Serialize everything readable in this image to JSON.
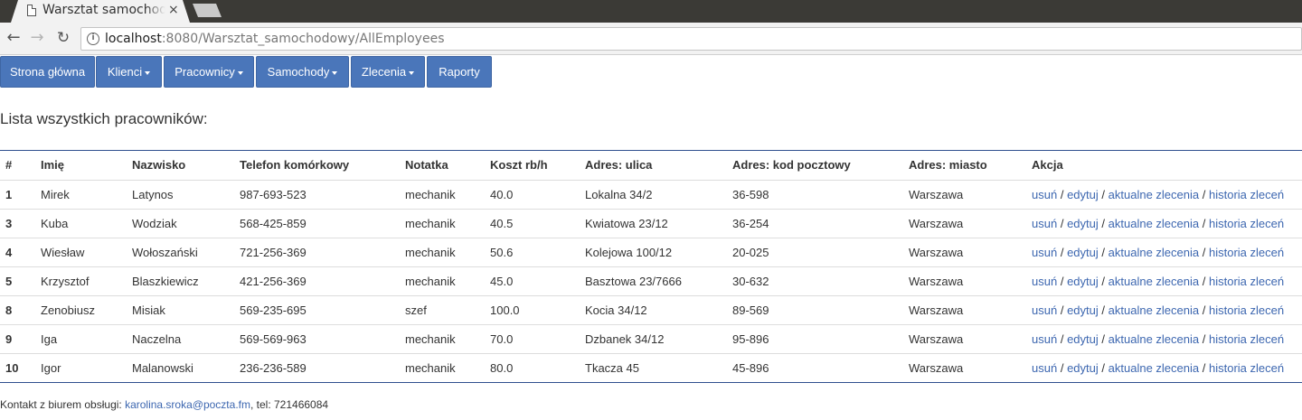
{
  "browser": {
    "tab_title": "Warsztat samochodowy",
    "tab_close": "×",
    "url_host": "localhost",
    "url_rest": ":8080/Warsztat_samochodowy/AllEmployees",
    "icons": [
      "back-arrow-icon",
      "forward-arrow-icon",
      "reload-icon",
      "info-icon",
      "document-icon",
      "close-icon"
    ]
  },
  "navbar": {
    "items": [
      {
        "label": "Strona główna",
        "dropdown": false
      },
      {
        "label": "Klienci",
        "dropdown": true
      },
      {
        "label": "Pracownicy",
        "dropdown": true
      },
      {
        "label": "Samochody",
        "dropdown": true
      },
      {
        "label": "Zlecenia",
        "dropdown": true
      },
      {
        "label": "Raporty",
        "dropdown": false
      }
    ],
    "color": "#4a76ba"
  },
  "page": {
    "heading": "Lista wszystkich pracowników:"
  },
  "table": {
    "columns": [
      "#",
      "Imię",
      "Nazwisko",
      "Telefon komórkowy",
      "Notatka",
      "Koszt rb/h",
      "Adres: ulica",
      "Adres: kod pocztowy",
      "Adres: miasto",
      "Akcja"
    ],
    "action_links": [
      "usuń",
      "edytuj",
      "aktualne zlecenia",
      "historia zleceń"
    ],
    "action_separator": "/",
    "rows": [
      {
        "id": "1",
        "first": "Mirek",
        "last": "Latynos",
        "phone": "987-693-523",
        "note": "mechanik",
        "rate": "40.0",
        "street": "Lokalna 34/2",
        "zip": "36-598",
        "city": "Warszawa"
      },
      {
        "id": "3",
        "first": "Kuba",
        "last": "Wodziak",
        "phone": "568-425-859",
        "note": "mechanik",
        "rate": "40.5",
        "street": "Kwiatowa 23/12",
        "zip": "36-254",
        "city": "Warszawa"
      },
      {
        "id": "4",
        "first": "Wiesław",
        "last": "Wołoszański",
        "phone": "721-256-369",
        "note": "mechanik",
        "rate": "50.6",
        "street": "Kolejowa 100/12",
        "zip": "20-025",
        "city": "Warszawa"
      },
      {
        "id": "5",
        "first": "Krzysztof",
        "last": "Blaszkiewicz",
        "phone": "421-256-369",
        "note": "mechanik",
        "rate": "45.0",
        "street": "Basztowa 23/7666",
        "zip": "30-632",
        "city": "Warszawa"
      },
      {
        "id": "8",
        "first": "Zenobiusz",
        "last": "Misiak",
        "phone": "569-235-695",
        "note": "szef",
        "rate": "100.0",
        "street": "Kocia 34/12",
        "zip": "89-569",
        "city": "Warszawa"
      },
      {
        "id": "9",
        "first": "Iga",
        "last": "Naczelna",
        "phone": "569-569-963",
        "note": "mechanik",
        "rate": "70.0",
        "street": "Dzbanek 34/12",
        "zip": "95-896",
        "city": "Warszawa"
      },
      {
        "id": "10",
        "first": "Igor",
        "last": "Malanowski",
        "phone": "236-236-589",
        "note": "mechanik",
        "rate": "80.0",
        "street": "Tkacza 45",
        "zip": "45-896",
        "city": "Warszawa"
      }
    ]
  },
  "footer": {
    "prefix": "Kontakt z biurem obsługi: ",
    "email": "karolina.sroka@poczta.fm",
    "suffix": ", tel: 721466084"
  }
}
